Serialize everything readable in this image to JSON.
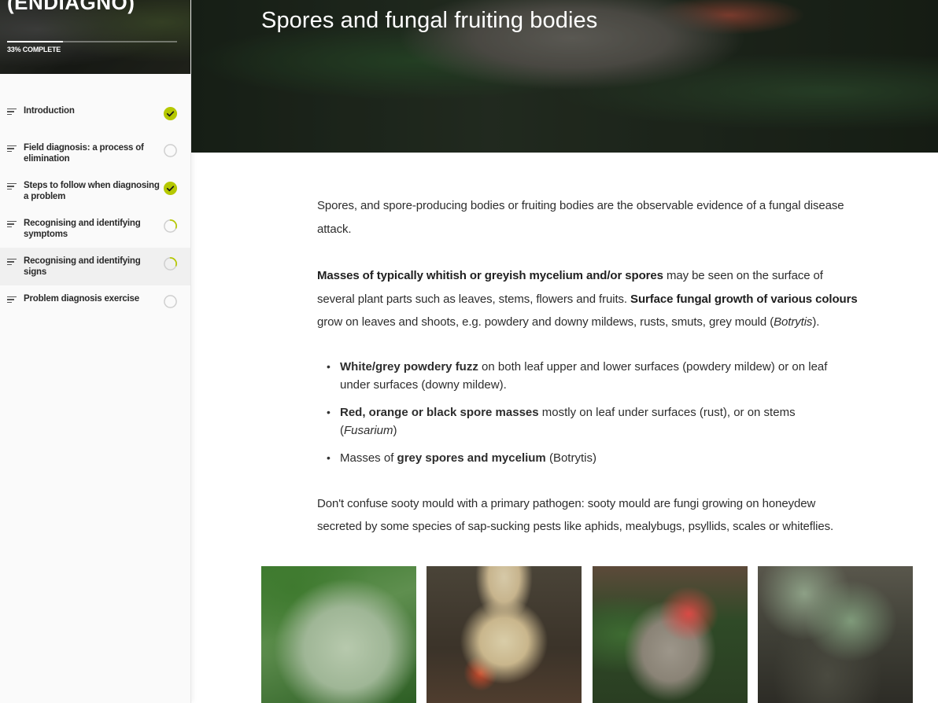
{
  "course": {
    "title": "(ENDIAGNO)",
    "progress_percent": 33,
    "progress_label": "33% COMPLETE"
  },
  "lessons": [
    {
      "label": "Introduction",
      "status": "complete"
    },
    {
      "label": "Field diagnosis: a process of elimination",
      "status": "not-started"
    },
    {
      "label": "Steps to follow when diagnosing a problem",
      "status": "complete"
    },
    {
      "label": "Recognising and identifying symptoms",
      "status": "in-progress"
    },
    {
      "label": "Recognising and identifying signs",
      "status": "in-progress",
      "active": true
    },
    {
      "label": "Problem diagnosis exercise",
      "status": "not-started"
    }
  ],
  "page": {
    "title": "Spores and fungal fruiting bodies"
  },
  "content": {
    "p1": "Spores, and spore-producing bodies or fruiting bodies are the observable evidence of a fungal disease attack.",
    "p2_b1": "Masses of typically whitish or greyish mycelium and/or spores",
    "p2_t1": " may be seen on the surface of several plant parts such as leaves, stems, flowers and fruits. ",
    "p2_b2": "Surface fungal growth of various colours",
    "p2_t2": " grow on leaves and shoots, e.g. powdery and downy mildews, rusts, smuts, grey mould (",
    "p2_i1": "Botrytis",
    "p2_t3": ").",
    "bullets": [
      {
        "bold": "White/grey powdery fuzz",
        "text": " on both leaf upper and lower surfaces (powdery mildew) or on leaf under surfaces (downy mildew).",
        "italic": "",
        "tail": ""
      },
      {
        "bold": "Red, orange or black spore masses",
        "text": " mostly on leaf under surfaces (rust), or on stems (",
        "italic": "Fusarium",
        "tail": ")"
      },
      {
        "lead": "Masses of ",
        "bold": "grey spores and mycelium",
        "text": " (Botrytis)",
        "italic": "",
        "tail": ""
      }
    ],
    "p3": "Don't confuse sooty mould with a primary pathogen:  sooty mould are fungi growing on honeydew secreted by some species of sap-sucking pests like aphids, mealybugs, psyllids, scales or whiteflies."
  },
  "colors": {
    "accent": "#b5c800",
    "check": "#1a1a1a",
    "ring": "#cfcfcf"
  },
  "icons": {
    "lesson": "menu-lines-icon",
    "complete": "checkmark-circle-icon",
    "in_progress": "partial-progress-ring-icon",
    "not_started": "empty-circle-icon"
  }
}
